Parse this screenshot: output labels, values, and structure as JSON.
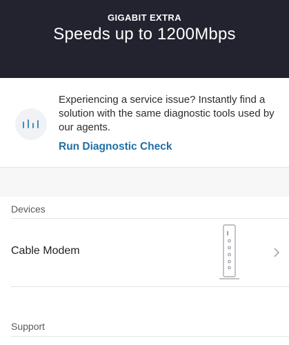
{
  "header": {
    "plan_name": "GIGABIT EXTRA",
    "speed_text": "Speeds up to 1200Mbps",
    "background": "#22232f"
  },
  "diagnostic": {
    "icon": "signal-bars-icon",
    "message": "Experiencing a service issue? Instantly find a solution with the same diagnostic tools used by our agents.",
    "action_label": "Run Diagnostic Check",
    "link_color": "#1f6fa6"
  },
  "devices": {
    "section_label": "Devices",
    "items": [
      {
        "name": "Cable Modem",
        "icon": "cable-modem-icon"
      }
    ]
  },
  "support": {
    "section_label": "Support"
  }
}
